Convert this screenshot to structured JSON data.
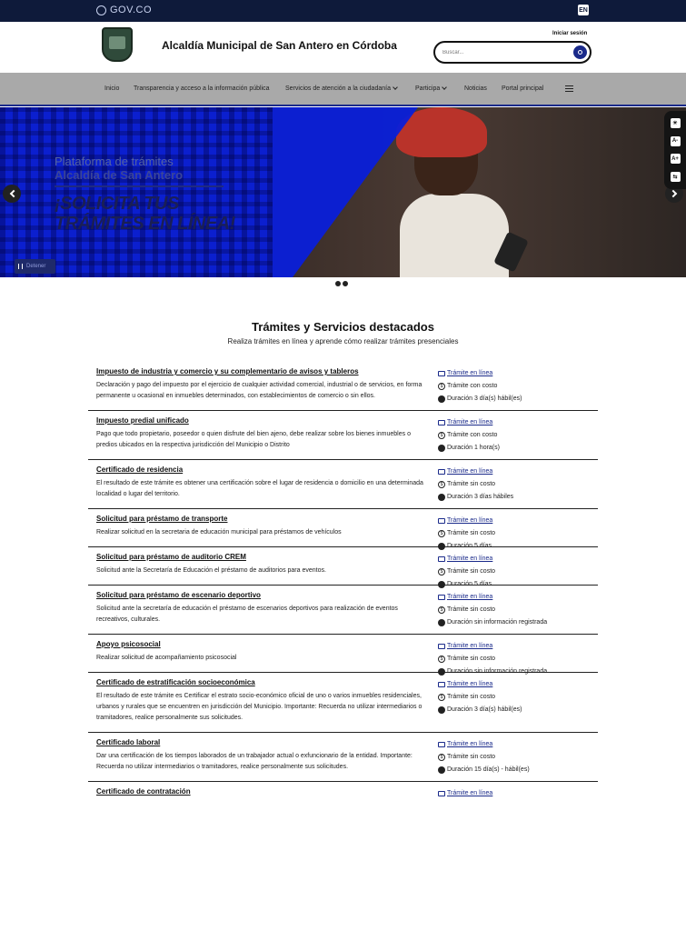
{
  "gov_bar": {
    "logo_text": "GOV.CO",
    "lang_label": "EN"
  },
  "header": {
    "site_title": "Alcaldía Municipal de San Antero en Córdoba",
    "login_label": "Iniciar sesión",
    "search_placeholder": "Buscar..."
  },
  "nav": {
    "items": [
      {
        "label": "Inicio"
      },
      {
        "label": "Transparencia y acceso a la información pública"
      },
      {
        "label": "Servicios de atención a la ciudadanía"
      },
      {
        "label": "Participa"
      },
      {
        "label": "Noticias"
      },
      {
        "label": "Portal principal"
      }
    ]
  },
  "hero": {
    "kicker": "Plataforma de trámites",
    "kicker_entity": "Alcaldía de San Antero",
    "headline_line1": "¡SOLICITA TUS",
    "headline_line2": "TRÁMITES EN LÍNEA!",
    "stop_label": "Detener"
  },
  "accessibility": {
    "buttons": [
      "☀",
      "A-",
      "A+",
      "⇆"
    ]
  },
  "section": {
    "title": "Trámites y Servicios destacados",
    "subtitle": "Realiza trámites en línea y aprende cómo realizar trámites presenciales"
  },
  "tramites": [
    {
      "title": "Impuesto de industria y comercio y su complementario de avisos y tableros",
      "desc": "Declaración y pago del impuesto por el ejercicio de cualquier actividad comercial, industrial o de servicios, en forma permanente u ocasional en inmuebles determinados, con establecimientos de comercio o sin ellos.",
      "mode": "Trámite en línea",
      "cost": "Trámite con costo",
      "duration": "Duración 3 día(s) hábil(es)"
    },
    {
      "title": "Impuesto predial unificado",
      "desc": "Pago que todo propietario, poseedor o quien disfrute del bien ajeno, debe realizar sobre los bienes inmuebles o predios ubicados en la respectiva jurisdicción del Municipio o Distrito",
      "mode": "Trámite en línea",
      "cost": "Trámite con costo",
      "duration": "Duración 1 hora(s)"
    },
    {
      "title": "Certificado de residencia",
      "desc": "El resultado de este trámite es obtener una certificación sobre el lugar de residencia o domicilio en una determinada localidad o lugar del territorio.",
      "mode": "Trámite en línea",
      "cost": "Trámite sin costo",
      "duration": "Duración 3 días hábiles"
    },
    {
      "title": "Solicitud para préstamo de transporte",
      "desc": "Realizar solicitud en la secretaria de educación municipal para préstamos de vehículos",
      "mode": "Trámite en línea",
      "cost": "Trámite sin costo",
      "duration": "Duración 5 días"
    },
    {
      "title": "Solicitud para préstamo de auditorio CREM",
      "desc": "Solicitud ante la Secretaría de Educación el préstamo de auditorios para eventos.",
      "mode": "Trámite en línea",
      "cost": "Trámite sin costo",
      "duration": "Duración 5 días"
    },
    {
      "title": "Solicitud para préstamo de escenario deportivo",
      "desc": "Solicitud ante la secretaría de educación el préstamo de escenarios deportivos para realización de eventos recreativos, culturales.",
      "mode": "Trámite en línea",
      "cost": "Trámite sin costo",
      "duration": "Duración sin información registrada"
    },
    {
      "title": "Apoyo psicosocial",
      "desc": "Realizar solicitud de acompañamiento psicosocial",
      "mode": "Trámite en línea",
      "cost": "Trámite sin costo",
      "duration": "Duración sin información registrada"
    },
    {
      "title": "Certificado de estratificación socioeconómica",
      "desc": "El resultado de este trámite es Certificar el estrato socio-económico oficial de uno o varios inmuebles residenciales, urbanos y rurales que se encuentren en jurisdicción del Municipio. Importante: Recuerda no utilizar intermediarios o tramitadores, realice personalmente sus solicitudes.",
      "mode": "Trámite en línea",
      "cost": "Trámite sin costo",
      "duration": "Duración 3 día(s) hábil(es)"
    },
    {
      "title": "Certificado laboral",
      "desc": "Dar una certificación de los tiempos laborados de un trabajador actual o exfuncionario de la entidad. Importante: Recuerda no utilizar intermediarios o tramitadores, realice personalmente sus solicitudes.",
      "mode": "Trámite en línea",
      "cost": "Trámite sin costo",
      "duration": "Duración 15 día(s) - hábil(es)"
    },
    {
      "title": "Certificado de contratación",
      "desc": "",
      "mode": "Trámite en línea",
      "cost": "",
      "duration": ""
    }
  ]
}
